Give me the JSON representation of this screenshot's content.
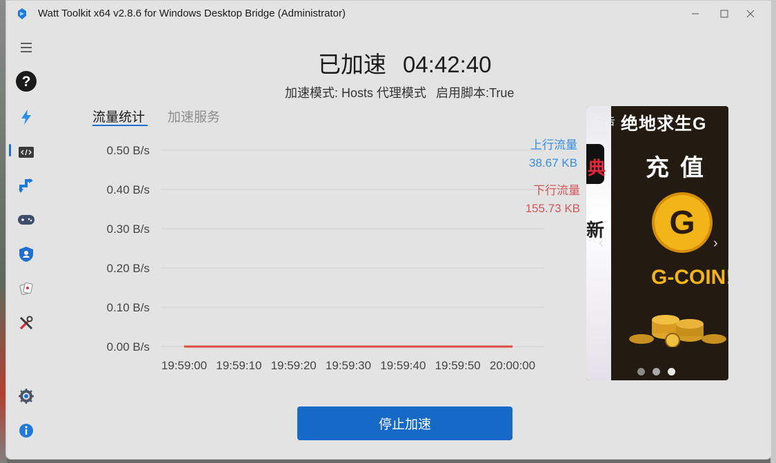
{
  "window": {
    "title": "Watt Toolkit x64 v2.8.6 for Windows Desktop Bridge (Administrator)",
    "controls": [
      "minimize",
      "maximize",
      "close"
    ]
  },
  "sidebar": {
    "items": [
      {
        "icon": "menu-icon"
      },
      {
        "icon": "help-icon"
      },
      {
        "icon": "lightning-icon",
        "active": true
      },
      {
        "icon": "code-icon"
      },
      {
        "icon": "sync-arrows-icon"
      },
      {
        "icon": "gamepad-icon"
      },
      {
        "icon": "shield-user-icon"
      },
      {
        "icon": "cards-icon"
      },
      {
        "icon": "tools-icon"
      },
      {
        "icon": "settings-icon"
      },
      {
        "icon": "info-icon"
      }
    ]
  },
  "status": {
    "label": "已加速",
    "time": "04:42:40",
    "mode_label": "加速模式:",
    "mode_value": "Hosts 代理模式",
    "script_label": "启用脚本:",
    "script_value": "True"
  },
  "tabs": [
    {
      "label": "流量统计",
      "active": true
    },
    {
      "label": "加速服务",
      "active": false
    }
  ],
  "chart_data": {
    "type": "line",
    "y_ticks": [
      "0.50 B/s",
      "0.40 B/s",
      "0.30 B/s",
      "0.20 B/s",
      "0.10 B/s",
      "0.00 B/s"
    ],
    "x_ticks": [
      "19:59:00",
      "19:59:10",
      "19:59:20",
      "19:59:30",
      "19:59:40",
      "19:59:50",
      "20:00:00"
    ],
    "ylim": [
      0,
      0.5
    ],
    "grid": true,
    "series": [
      {
        "name": "上行流量",
        "total": "38.67 KB",
        "color": "#3a8de0",
        "x": [
          "19:59:00",
          "20:00:00"
        ],
        "values": [
          0,
          0
        ]
      },
      {
        "name": "下行流量",
        "total": "155.73 KB",
        "color": "#e04a3f",
        "x": [
          "19:59:00",
          "20:00:00"
        ],
        "values": [
          0,
          0
        ]
      }
    ]
  },
  "ad": {
    "label": "广告",
    "title": "绝地求生G",
    "subtitle": "充值",
    "coin_letter": "G",
    "coin_text": "G-COIN!",
    "left_red": "典",
    "left_text": "新",
    "prev": "‹",
    "next": "›"
  },
  "actions": {
    "stop_label": "停止加速"
  }
}
